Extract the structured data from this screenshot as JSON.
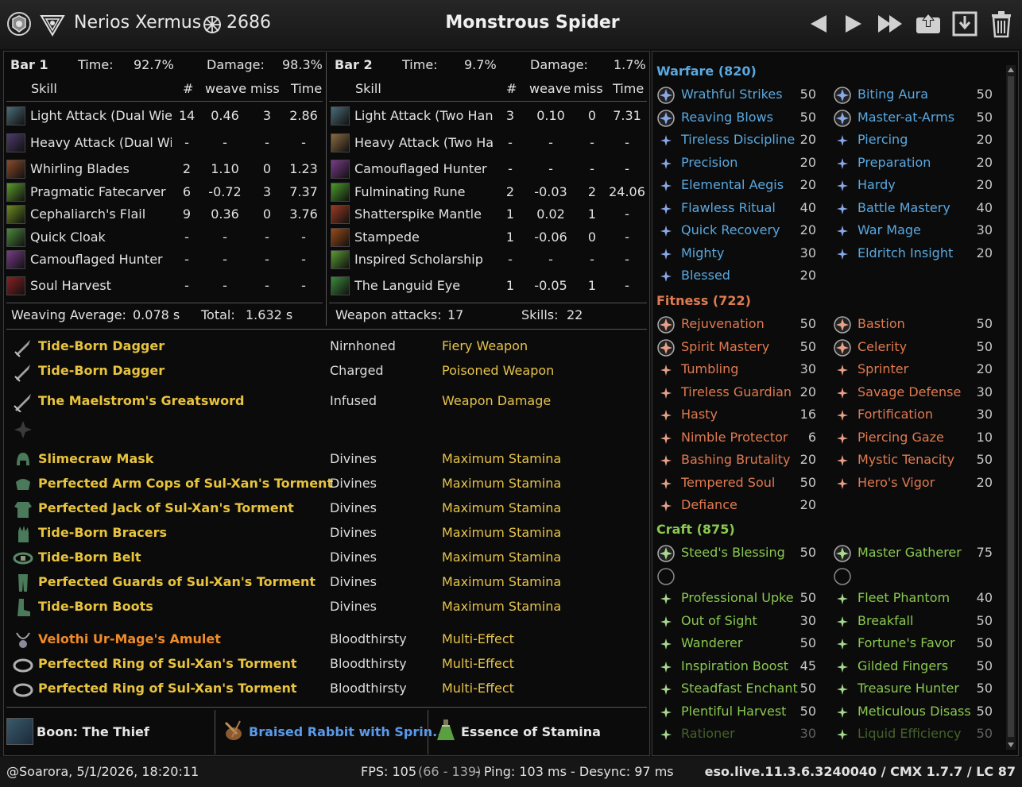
{
  "header": {
    "player": "Nerios Xermus",
    "cp": "2686",
    "target": "Monstrous Spider"
  },
  "bar1": {
    "label": "Bar 1",
    "time_label": "Time:",
    "time": "92.7%",
    "damage_label": "Damage:",
    "damage": "98.3%",
    "cols": {
      "skill": "Skill",
      "count": "#",
      "weave": "weave",
      "miss": "miss",
      "time": "Time"
    },
    "rows": [
      {
        "name": "Light Attack (Dual Wie",
        "count": "14",
        "weave": "0.46",
        "miss": "3",
        "time": "2.86",
        "color": "#4a6c78"
      },
      {
        "name": "Heavy Attack (Dual Wi",
        "count": "-",
        "weave": "-",
        "miss": "-",
        "time": "-",
        "color": "#4a3a6a"
      },
      {
        "name": "Whirling Blades",
        "count": "2",
        "weave": "1.10",
        "miss": "0",
        "time": "1.23",
        "color": "#8a4a28"
      },
      {
        "name": "Pragmatic Fatecarver",
        "count": "6",
        "weave": "-0.72",
        "miss": "3",
        "time": "7.37",
        "color": "#5a9a2a"
      },
      {
        "name": "Cephaliarch's Flail",
        "count": "9",
        "weave": "0.36",
        "miss": "0",
        "time": "3.76",
        "color": "#6a8a20"
      },
      {
        "name": "Quick Cloak",
        "count": "-",
        "weave": "-",
        "miss": "-",
        "time": "-",
        "color": "#4a8a3a"
      },
      {
        "name": "Camouflaged Hunter",
        "count": "-",
        "weave": "-",
        "miss": "-",
        "time": "-",
        "color": "#7a3a8a"
      },
      {
        "name": "Soul Harvest",
        "count": "-",
        "weave": "-",
        "miss": "-",
        "time": "-",
        "color": "#8a2020"
      }
    ],
    "weave_label": "Weaving Average:",
    "weave_avg": "0.078 s",
    "total_label": "Total:",
    "total": "1.632 s"
  },
  "bar2": {
    "label": "Bar 2",
    "time_label": "Time:",
    "time": "9.7%",
    "damage_label": "Damage:",
    "damage": "1.7%",
    "cols": {
      "skill": "Skill",
      "count": "#",
      "weave": "weave",
      "miss": "miss",
      "time": "Time"
    },
    "rows": [
      {
        "name": "Light Attack (Two Han",
        "count": "3",
        "weave": "0.10",
        "miss": "0",
        "time": "7.31",
        "color": "#4a6c78"
      },
      {
        "name": "Heavy Attack (Two Ha",
        "count": "-",
        "weave": "-",
        "miss": "-",
        "time": "-",
        "color": "#8a6a40"
      },
      {
        "name": "Camouflaged Hunter",
        "count": "-",
        "weave": "-",
        "miss": "-",
        "time": "-",
        "color": "#7a3a8a"
      },
      {
        "name": "Fulminating Rune",
        "count": "2",
        "weave": "-0.03",
        "miss": "2",
        "time": "24.06",
        "color": "#4a9a2a"
      },
      {
        "name": "Shatterspike Mantle",
        "count": "1",
        "weave": "0.02",
        "miss": "1",
        "time": "-",
        "color": "#9a3a20"
      },
      {
        "name": "Stampede",
        "count": "1",
        "weave": "-0.06",
        "miss": "0",
        "time": "-",
        "color": "#9a4a18"
      },
      {
        "name": "Inspired Scholarship",
        "count": "-",
        "weave": "-",
        "miss": "-",
        "time": "-",
        "color": "#5a9a30"
      },
      {
        "name": "The Languid Eye",
        "count": "1",
        "weave": "-0.05",
        "miss": "1",
        "time": "-",
        "color": "#3a8a3a"
      }
    ],
    "weapon_label": "Weapon attacks:",
    "weapon_attacks": "17",
    "skills_label": "Skills:",
    "skills": "22"
  },
  "gear": [
    {
      "name": "Tide-Born Dagger",
      "trait": "Nirnhoned",
      "enchant": "Fiery Weapon",
      "color": "#e8c33d",
      "icon": "dagger-icon"
    },
    {
      "name": "Tide-Born Dagger",
      "trait": "Charged",
      "enchant": "Poisoned Weapon",
      "color": "#e8c33d",
      "icon": "dagger-icon"
    },
    {
      "name": "The Maelstrom's Greatsword",
      "trait": "Infused",
      "enchant": "Weapon Damage",
      "color": "#e8c33d",
      "icon": "greatsword-icon"
    },
    {
      "name": "Slimecraw Mask",
      "trait": "Divines",
      "enchant": "Maximum Stamina",
      "color": "#e8c33d",
      "icon": "helmet-icon"
    },
    {
      "name": "Perfected Arm Cops of Sul-Xan's Torment",
      "trait": "Divines",
      "enchant": "Maximum Stamina",
      "color": "#e8c33d",
      "icon": "shoulders-icon"
    },
    {
      "name": "Perfected Jack of Sul-Xan's Torment",
      "trait": "Divines",
      "enchant": "Maximum Stamina",
      "color": "#e8c33d",
      "icon": "chest-icon"
    },
    {
      "name": "Tide-Born Bracers",
      "trait": "Divines",
      "enchant": "Maximum Stamina",
      "color": "#e8c33d",
      "icon": "gloves-icon"
    },
    {
      "name": "Tide-Born Belt",
      "trait": "Divines",
      "enchant": "Maximum Stamina",
      "color": "#e8c33d",
      "icon": "belt-icon"
    },
    {
      "name": "Perfected Guards of Sul-Xan's Torment",
      "trait": "Divines",
      "enchant": "Maximum Stamina",
      "color": "#e8c33d",
      "icon": "legs-icon"
    },
    {
      "name": "Tide-Born Boots",
      "trait": "Divines",
      "enchant": "Maximum Stamina",
      "color": "#e8c33d",
      "icon": "boots-icon"
    },
    {
      "name": "Velothi Ur-Mage's Amulet",
      "trait": "Bloodthirsty",
      "enchant": "Multi-Effect",
      "color": "#f08a28",
      "icon": "amulet-icon"
    },
    {
      "name": "Perfected Ring of Sul-Xan's Torment",
      "trait": "Bloodthirsty",
      "enchant": "Multi-Effect",
      "color": "#e8c33d",
      "icon": "ring-icon"
    },
    {
      "name": "Perfected Ring of Sul-Xan's Torment",
      "trait": "Bloodthirsty",
      "enchant": "Multi-Effect",
      "color": "#e8c33d",
      "icon": "ring-icon"
    }
  ],
  "buffs": {
    "boon": "Boon: The Thief",
    "food": "Braised Rabbit with Sprin...",
    "potion": "Essence of Stamina"
  },
  "cp_tree": {
    "warfare": {
      "title": "Warfare (820)",
      "color": "#5aa8e0",
      "star_color": "#8aa8e8",
      "slotted": [
        {
          "name": "Wrathful Strikes",
          "value": "50"
        },
        {
          "name": "Biting Aura",
          "value": "50"
        },
        {
          "name": "Reaving Blows",
          "value": "50"
        },
        {
          "name": "Master-at-Arms",
          "value": "50"
        }
      ],
      "passive": [
        {
          "name": "Tireless Discipline",
          "value": "20"
        },
        {
          "name": "Piercing",
          "value": "20"
        },
        {
          "name": "Precision",
          "value": "20"
        },
        {
          "name": "Preparation",
          "value": "20"
        },
        {
          "name": "Elemental Aegis",
          "value": "20"
        },
        {
          "name": "Hardy",
          "value": "20"
        },
        {
          "name": "Flawless Ritual",
          "value": "40"
        },
        {
          "name": "Battle Mastery",
          "value": "40"
        },
        {
          "name": "Quick Recovery",
          "value": "20"
        },
        {
          "name": "War Mage",
          "value": "30"
        },
        {
          "name": "Mighty",
          "value": "30"
        },
        {
          "name": "Eldritch Insight",
          "value": "20"
        },
        {
          "name": "Blessed",
          "value": "20"
        }
      ]
    },
    "fitness": {
      "title": "Fitness (722)",
      "color": "#e07a50",
      "star_color": "#e8a088",
      "slotted": [
        {
          "name": "Rejuvenation",
          "value": "50"
        },
        {
          "name": "Bastion",
          "value": "50"
        },
        {
          "name": "Spirit Mastery",
          "value": "50"
        },
        {
          "name": "Celerity",
          "value": "50"
        }
      ],
      "passive": [
        {
          "name": "Tumbling",
          "value": "30"
        },
        {
          "name": "Sprinter",
          "value": "20"
        },
        {
          "name": "Tireless Guardian",
          "value": "20"
        },
        {
          "name": "Savage Defense",
          "value": "30"
        },
        {
          "name": "Hasty",
          "value": "16"
        },
        {
          "name": "Fortification",
          "value": "30"
        },
        {
          "name": "Nimble Protector",
          "value": "6"
        },
        {
          "name": "Piercing Gaze",
          "value": "10"
        },
        {
          "name": "Bashing Brutality",
          "value": "20"
        },
        {
          "name": "Mystic Tenacity",
          "value": "50"
        },
        {
          "name": "Tempered Soul",
          "value": "50"
        },
        {
          "name": "Hero's Vigor",
          "value": "20"
        },
        {
          "name": "Defiance",
          "value": "20"
        }
      ]
    },
    "craft": {
      "title": "Craft (875)",
      "color": "#8ac850",
      "star_color": "#a8d890",
      "slotted": [
        {
          "name": "Steed's Blessing",
          "value": "50"
        },
        {
          "name": "Master Gatherer",
          "value": "75"
        }
      ],
      "passive": [
        {
          "name": "Professional Upke",
          "value": "50"
        },
        {
          "name": "Fleet Phantom",
          "value": "40"
        },
        {
          "name": "Out of Sight",
          "value": "30"
        },
        {
          "name": "Breakfall",
          "value": "50"
        },
        {
          "name": "Wanderer",
          "value": "50"
        },
        {
          "name": "Fortune's Favor",
          "value": "50"
        },
        {
          "name": "Inspiration Boost",
          "value": "45"
        },
        {
          "name": "Gilded Fingers",
          "value": "50"
        },
        {
          "name": "Steadfast Enchant",
          "value": "50"
        },
        {
          "name": "Treasure Hunter",
          "value": "50"
        },
        {
          "name": "Plentiful Harvest",
          "value": "50"
        },
        {
          "name": "Meticulous Disass",
          "value": "50"
        },
        {
          "name": "Rationer",
          "value": "30"
        },
        {
          "name": "Liquid Efficiency",
          "value": "50"
        }
      ]
    }
  },
  "status": {
    "user": "@Soarora, 5/1/2026, 18:20:11",
    "fps_label": "FPS: 105",
    "fps_range": "(66 - 139)",
    "ping": "- Ping: 103 ms - Desync: 97 ms",
    "version": "eso.live.11.3.6.3240040 / CMX 1.7.7 / LC 87"
  }
}
